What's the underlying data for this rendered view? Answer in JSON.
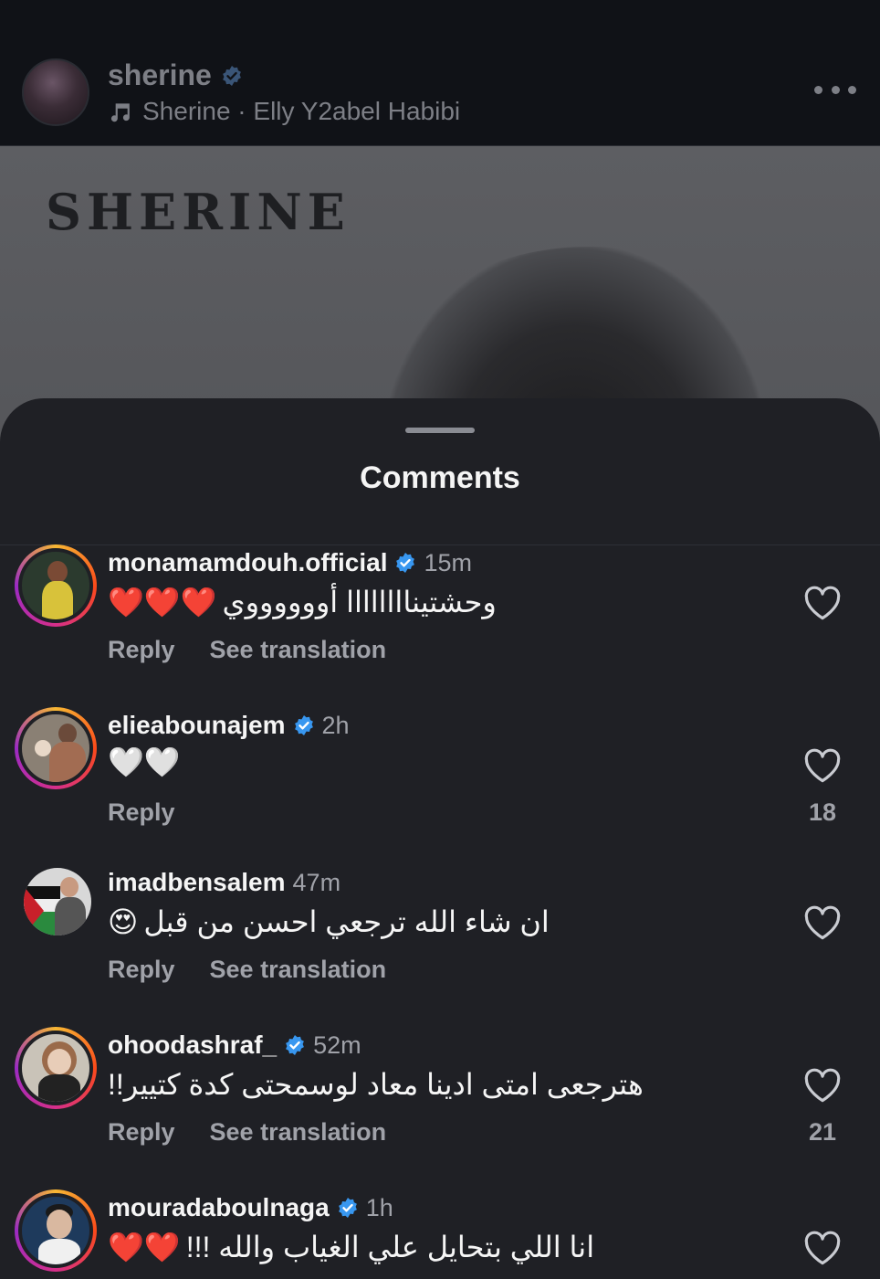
{
  "post": {
    "username": "sherine",
    "track": "Sherine · Elly Y2abel Habibi",
    "media_wordmark": "SHERINE"
  },
  "sheet": {
    "title": "Comments"
  },
  "colors": {
    "verified": "#3897f0",
    "muted": "#a0a2a9",
    "heart_emoji": "#e0243b"
  },
  "comments": [
    {
      "username": "monamamdouh.official",
      "verified": true,
      "time": "15m",
      "text": "وحشتيناااااااا أووووووي",
      "emoji_suffix": "❤️❤️❤️",
      "reply": "Reply",
      "translate": "See translation",
      "likes": ""
    },
    {
      "username": "elieabounajem",
      "verified": true,
      "time": "2h",
      "text": "",
      "emoji_suffix": "🤍🤍",
      "reply": "Reply",
      "translate": "",
      "likes": "18"
    },
    {
      "username": "imadbensalem",
      "verified": false,
      "time": "47m",
      "text": "ان شاء الله ترجعي احسن من قبل",
      "emoji_suffix": "😍",
      "reply": "Reply",
      "translate": "See translation",
      "likes": ""
    },
    {
      "username": "ohoodashraf_",
      "verified": true,
      "time": "52m",
      "text": "هترجعى امتى ادينا معاد لوسمحتى كدة كتيير!!",
      "emoji_suffix": "",
      "reply": "Reply",
      "translate": "See translation",
      "likes": "21"
    },
    {
      "username": "mouradaboulnaga",
      "verified": true,
      "time": "1h",
      "text": "انا اللي بتحايل علي الغياب والله !!!",
      "emoji_suffix": "❤️❤️",
      "reply": "",
      "translate": "",
      "likes": ""
    }
  ]
}
